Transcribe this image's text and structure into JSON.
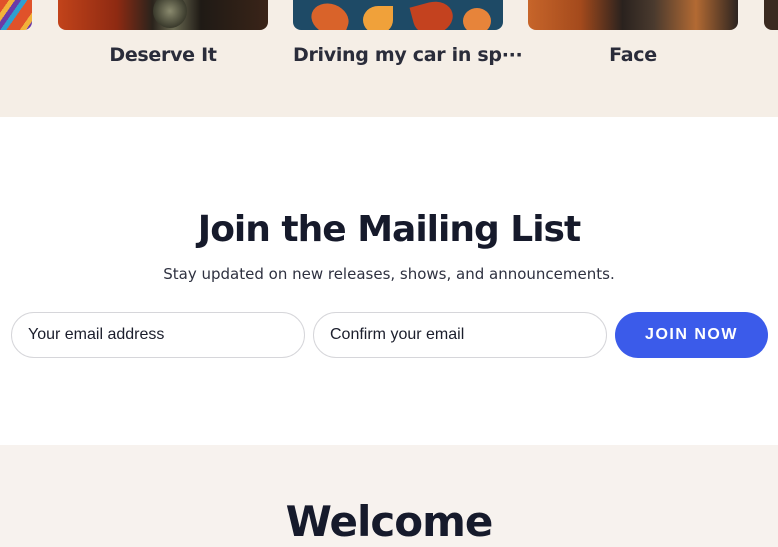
{
  "carousel": {
    "items": [
      {
        "title": "",
        "image": "colorful-swirl-artwork"
      },
      {
        "title": "Deserve It",
        "image": "deserve-it-cover"
      },
      {
        "title": "Driving my car in sp···",
        "image": "driving-my-car-cover"
      },
      {
        "title": "Face",
        "image": "face-cover"
      },
      {
        "title": "",
        "image": "partial-cover"
      }
    ]
  },
  "mailing": {
    "title": "Join the Mailing List",
    "subtitle": "Stay updated on new releases, shows, and announcements.",
    "email_placeholder": "Your email address",
    "confirm_placeholder": "Confirm your email",
    "submit_label": "JOIN NOW",
    "accent_color": "#3b5bea"
  },
  "welcome": {
    "title": "Welcome"
  },
  "colors": {
    "band_background": "#f5eee6",
    "text_dark": "#161a2b"
  }
}
